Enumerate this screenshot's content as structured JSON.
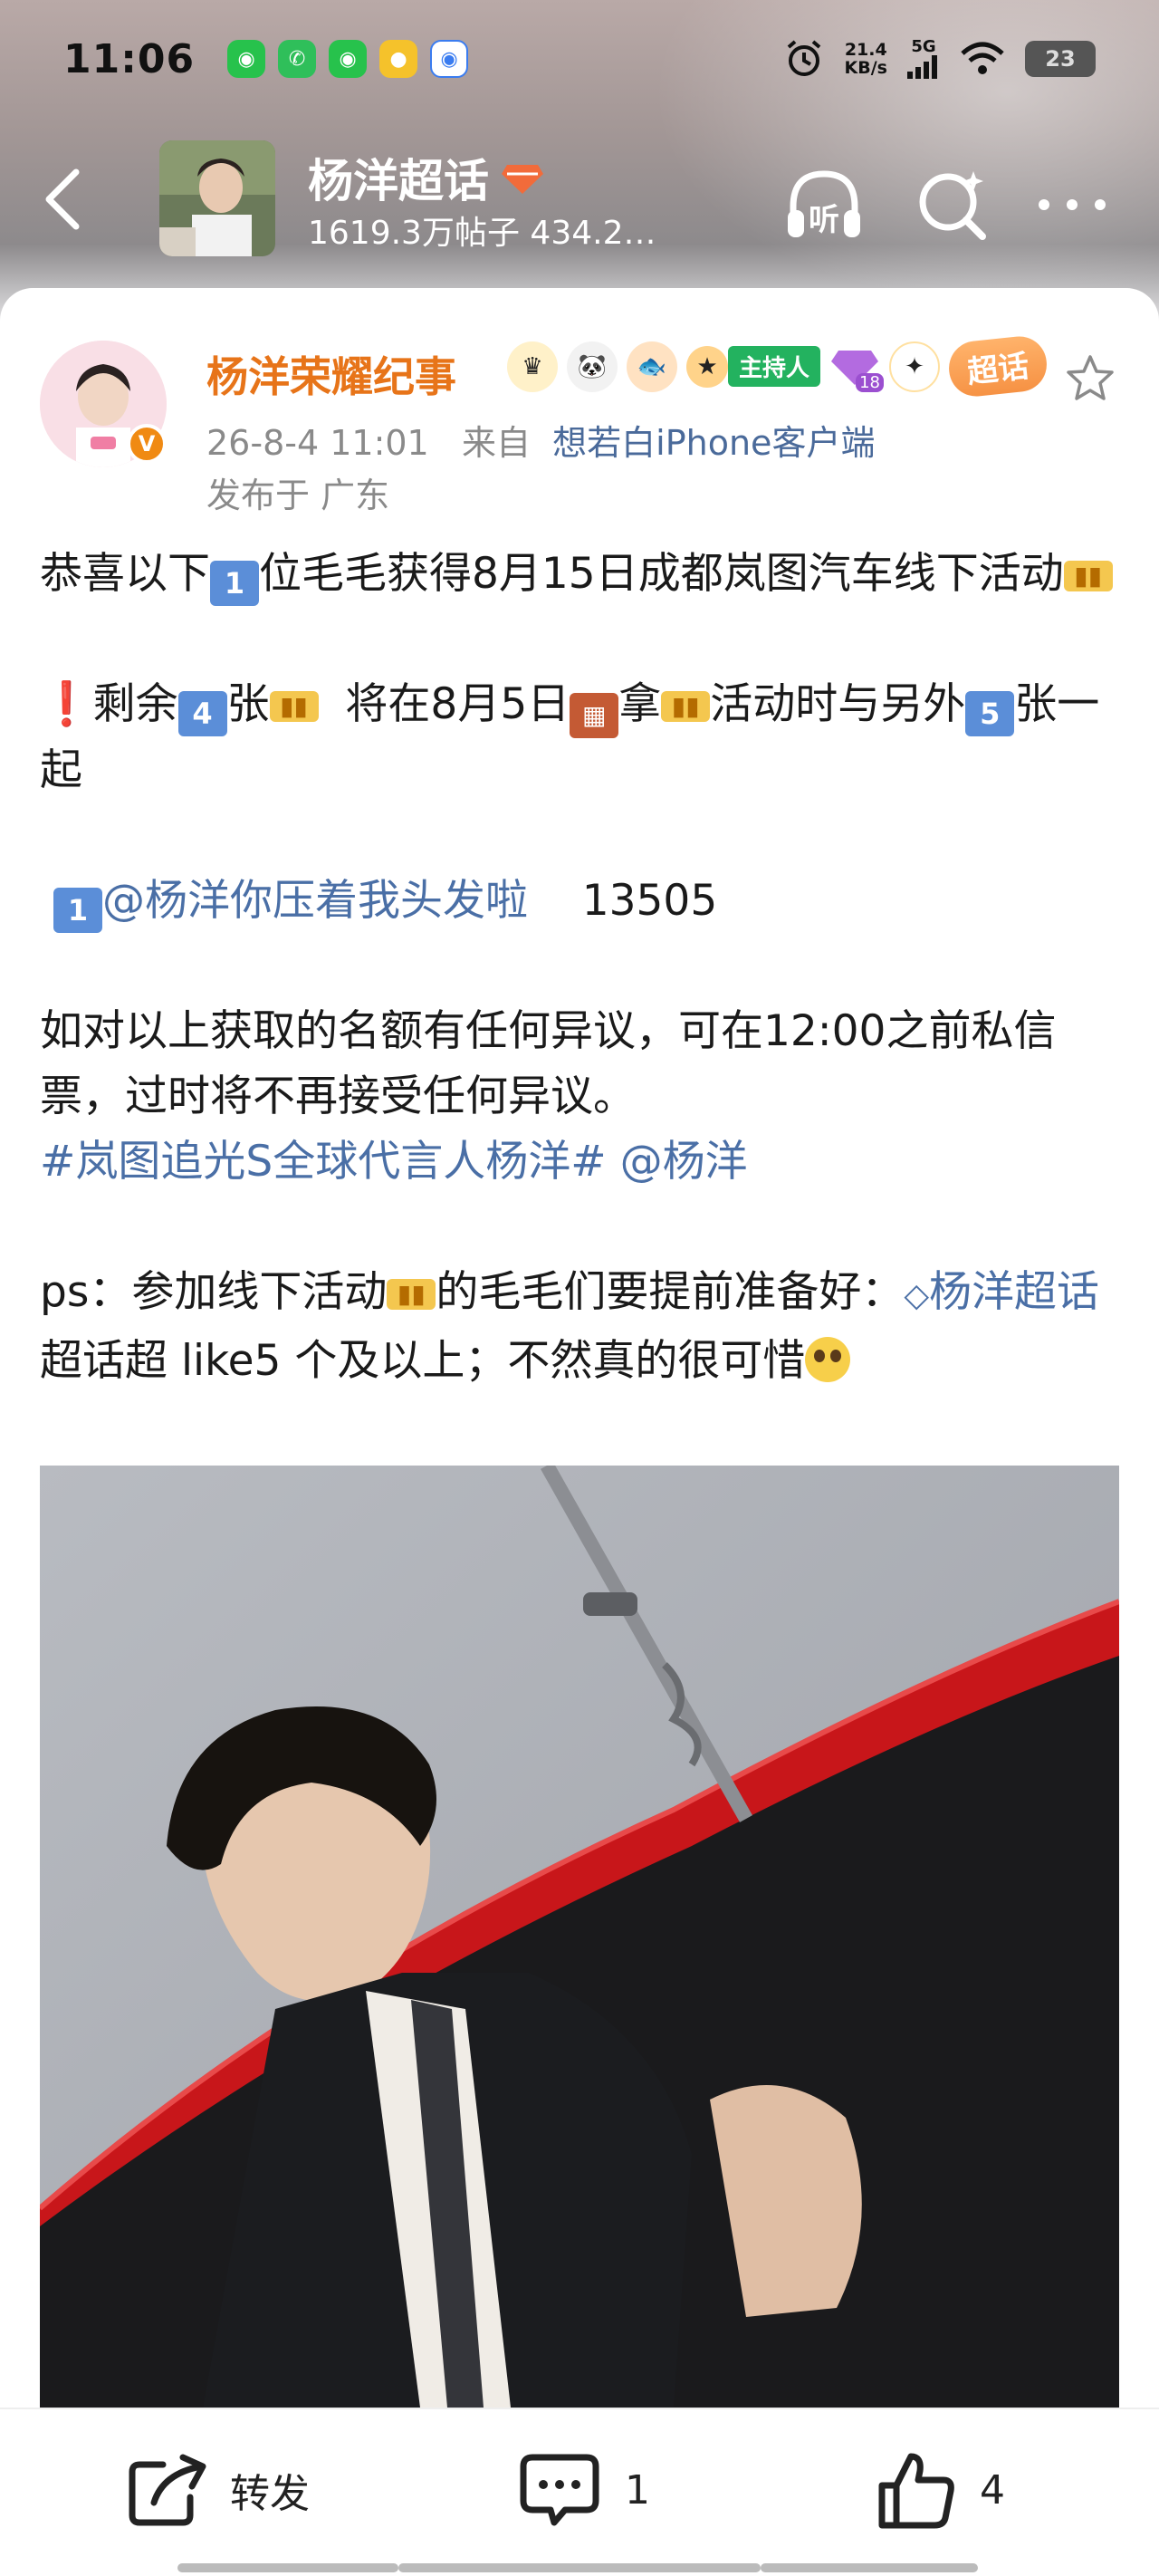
{
  "status_bar": {
    "time": "11:06",
    "speed_value": "21.4",
    "speed_unit": "KB/s",
    "network": "5G",
    "battery": "23",
    "apps": [
      {
        "icon": "wechat-icon",
        "glyph": "●",
        "color": "#27c24c"
      },
      {
        "icon": "phone-app-icon",
        "glyph": "✆",
        "color": "#2fbf5a"
      },
      {
        "icon": "wechat-icon",
        "glyph": "●",
        "color": "#27c24c"
      },
      {
        "icon": "fruit-app-icon",
        "glyph": "●",
        "color": "#f5c22b"
      },
      {
        "icon": "map-app-icon",
        "glyph": "◉",
        "color": "#3a7cf0"
      }
    ]
  },
  "nav": {
    "title": "杨洋超话",
    "subtitle": "1619.3万帖子 434.2…",
    "listen_label": "听"
  },
  "post": {
    "author": "杨洋荣耀纪事",
    "host_badge": "主持人",
    "level_badge": "18",
    "chaohua_badge": "超话",
    "verified": "V",
    "time": "26-8-4 11:01",
    "from_label": "来自",
    "source": "想若白iPhone客户端",
    "location": "发布于 广东",
    "text": {
      "l1_a": "恭喜以下",
      "l1_num": "1",
      "l1_b": "位毛毛获得8月15日成都岚图汽车线下活动",
      "l2_a": "剩余",
      "l2_num": "4",
      "l2_b": "张",
      "l2_c": "  将在8月5日",
      "l2_d": "拿",
      "l2_e": "活动时与另外",
      "l2_num2": "5",
      "l2_f": "张一起",
      "l3_num": "1",
      "l3_mention": "@杨洋你压着我头发啦",
      "l3_id": "13505",
      "l4": "如对以上获取的名额有任何异议，可在12:00之前私信票，过时将不再接受任何异议。",
      "hashtag": "#岚图追光S全球代言人杨洋#",
      "mention2": "@杨洋",
      "l5_a": "ps：参加线下活动",
      "l5_b": "的毛毛们要提前准备好：",
      "l5_link": "杨洋超话",
      "l5_c": " 超话超 like5 个及以上；不然真的很可惜"
    }
  },
  "actions": {
    "repost_label": "转发",
    "comment_count": "1",
    "like_count": "4"
  }
}
